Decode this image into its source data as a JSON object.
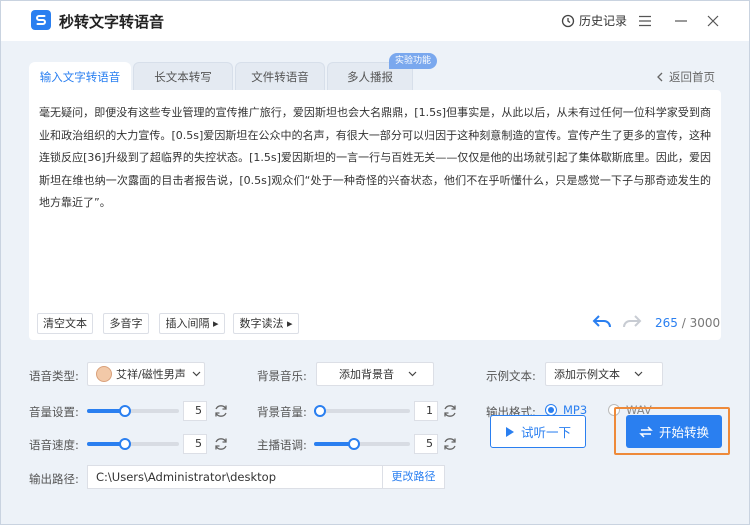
{
  "app": {
    "title": "秒转文字转语音",
    "history_label": "历史记录"
  },
  "tabs": [
    {
      "label": "输入文字转语音",
      "active": true
    },
    {
      "label": "长文本转写",
      "active": false
    },
    {
      "label": "文件转语音",
      "active": false
    },
    {
      "label": "多人播报",
      "active": false
    }
  ],
  "badge": "实验功能",
  "back_label": "返回首页",
  "editor": {
    "text": "毫无疑问，即便没有这些专业管理的宣传推广旅行，爱因斯坦也会大名鼎鼎，[1.5s]但事实是，从此以后，从未有过任何一位科学家受到商业和政治组织的大力宣传。[0.5s]爱因斯坦在公众中的名声，有很大一部分可以归因于这种刻意制造的宣传。宣传产生了更多的宣传，这种连锁反应[36]升级到了超临界的失控状态。[1.5s]爱因斯坦的一言一行与百姓无关——仅仅是他的出场就引起了集体歇斯底里。因此，爱因斯坦在维也纳一次露面的目击者报告说，[0.5s]观众们“处于一种奇怪的兴奋状态，他们不在乎听懂什么，只是感觉一下子与那奇迹发生的地方靠近了”。",
    "buttons": {
      "clear": "清空文本",
      "polyphone": "多音字",
      "insert_pause": "插入间隔 ▸",
      "number_reading": "数字读法 ▸"
    },
    "char_count": "265",
    "char_limit": "/ 3000"
  },
  "settings": {
    "voice_type_label": "语音类型:",
    "voice_value": "艾祥/磁性男声",
    "bgm_label": "背景音乐:",
    "bgm_value": "添加背景音",
    "example_label": "示例文本:",
    "example_value": "添加示例文本",
    "volume_label": "音量设置:",
    "volume_value": "5",
    "volume_fraction": 0.4,
    "bg_volume_label": "背景音量:",
    "bg_volume_value": "1",
    "bg_volume_fraction": 0.0,
    "format_label": "输出格式:",
    "format_options": [
      "MP3",
      "WAV"
    ],
    "format_selected": "MP3",
    "speed_label": "语音速度:",
    "speed_value": "5",
    "speed_fraction": 0.4,
    "pitch_label": "主播语调:",
    "pitch_value": "5",
    "pitch_fraction": 0.4,
    "path_label": "输出路径:",
    "path_value": "C:\\Users\\Administrator\\desktop",
    "path_button": "更改路径"
  },
  "actions": {
    "preview": "试听一下",
    "start": "开始转换"
  },
  "colors": {
    "accent": "#2a7ff0",
    "highlight": "#ee8a3a",
    "panel": "#edf2f8"
  }
}
